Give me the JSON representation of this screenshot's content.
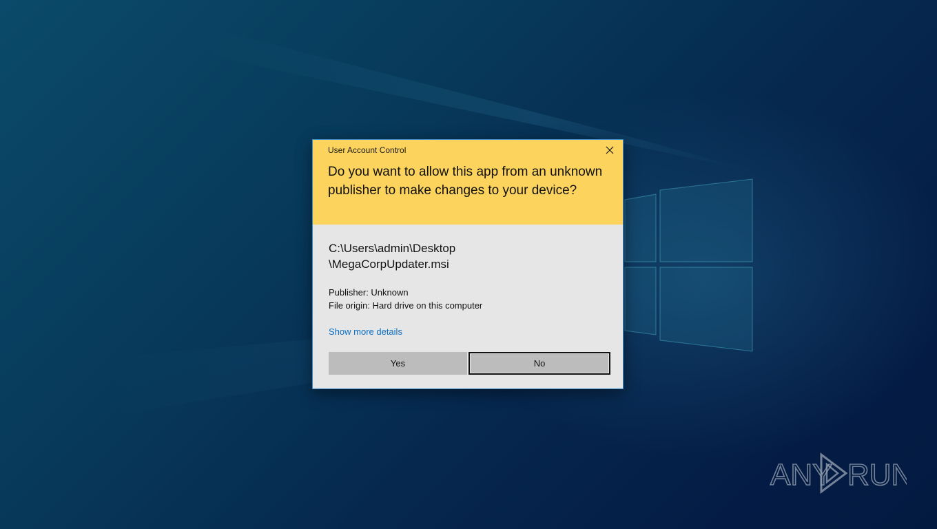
{
  "dialog": {
    "window_title": "User Account Control",
    "question": "Do you want to allow this app from an unknown publisher to make changes to your device?",
    "file_path_line1": "C:\\Users\\admin\\Desktop",
    "file_path_line2": "\\MegaCorpUpdater.msi",
    "publisher": "Publisher: Unknown",
    "file_origin": "File origin: Hard drive on this computer",
    "show_more_details": "Show more details",
    "yes_label": "Yes",
    "no_label": "No",
    "close_icon": "close-icon"
  },
  "watermark": {
    "text_left": "ANY",
    "text_right": "RUN",
    "icon": "play-triangle-icon"
  },
  "colors": {
    "header_bg": "#fcd35d",
    "dialog_bg": "#e6e6e6",
    "link": "#0a6fc2",
    "button_bg": "#bcbcbc",
    "desktop_bg": "#06284f"
  }
}
